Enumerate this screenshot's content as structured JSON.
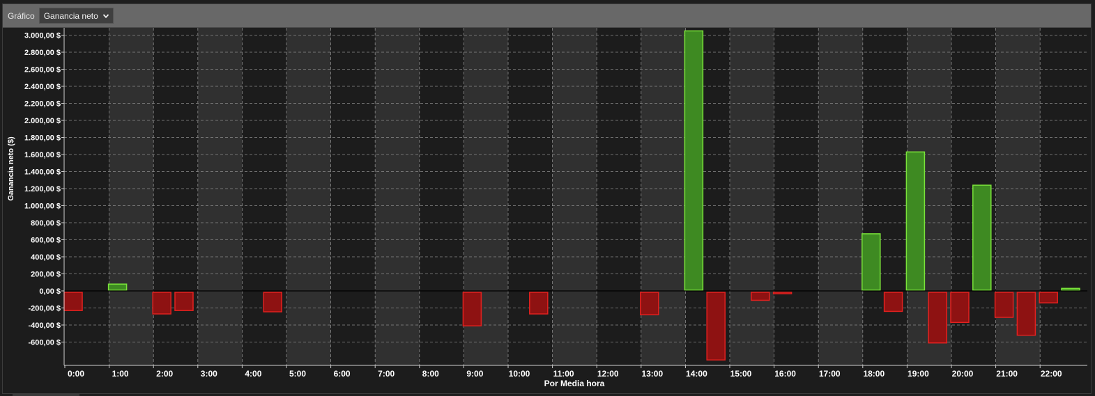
{
  "toolbar": {
    "label": "Gráfico",
    "selected_metric": "Ganancia neto",
    "chevron_icon": "chevron-down-icon"
  },
  "colors": {
    "positive_fill": "#3e8a22",
    "positive_stroke": "#7ae23a",
    "negative_fill": "#8e1212",
    "negative_stroke": "#e3211f",
    "band_light": "#303030",
    "band_dark": "#1c1c1c",
    "grid": "#8a8a8a",
    "text": "#ffffff"
  },
  "chart_data": {
    "type": "bar",
    "title": "",
    "xlabel": "Por Media hora",
    "ylabel": "Ganancia neto ($)",
    "ylim": [
      -850,
      3050
    ],
    "yticks": [
      3000,
      2800,
      2600,
      2400,
      2200,
      2000,
      1800,
      1600,
      1400,
      1200,
      1000,
      800,
      600,
      400,
      200,
      0,
      -200,
      -400,
      -600
    ],
    "ytick_labels": [
      "3.000,00 $",
      "2.800,00 $",
      "2.600,00 $",
      "2.400,00 $",
      "2.200,00 $",
      "2.000,00 $",
      "1.800,00 $",
      "1.600,00 $",
      "1.400,00 $",
      "1.200,00 $",
      "1.000,00 $",
      "800,00 $",
      "600,00 $",
      "400,00 $",
      "200,00 $",
      "0,00 $",
      "-200,00 $",
      "-400,00 $",
      "-600,00 $"
    ],
    "xtick_labels": [
      "0:00",
      "1:00",
      "2:00",
      "3:00",
      "4:00",
      "5:00",
      "6:00",
      "7:00",
      "8:00",
      "9:00",
      "10:00",
      "11:00",
      "12:00",
      "13:00",
      "14:00",
      "15:00",
      "16:00",
      "17:00",
      "18:00",
      "19:00",
      "20:00",
      "21:00",
      "22:00"
    ],
    "grid": true,
    "legend": "none",
    "bars": [
      {
        "x": 0.0,
        "value": -230
      },
      {
        "x": 1.0,
        "value": 80
      },
      {
        "x": 2.0,
        "value": -270
      },
      {
        "x": 2.5,
        "value": -230
      },
      {
        "x": 4.5,
        "value": -245
      },
      {
        "x": 9.0,
        "value": -410
      },
      {
        "x": 10.5,
        "value": -270
      },
      {
        "x": 13.0,
        "value": -280
      },
      {
        "x": 14.0,
        "value": 3050
      },
      {
        "x": 14.5,
        "value": -810
      },
      {
        "x": 15.5,
        "value": -110
      },
      {
        "x": 16.0,
        "value": -20
      },
      {
        "x": 18.0,
        "value": 670
      },
      {
        "x": 18.5,
        "value": -240
      },
      {
        "x": 19.0,
        "value": 1630
      },
      {
        "x": 19.5,
        "value": -610
      },
      {
        "x": 20.0,
        "value": -370
      },
      {
        "x": 20.5,
        "value": 1240
      },
      {
        "x": 21.0,
        "value": -310
      },
      {
        "x": 21.5,
        "value": -520
      },
      {
        "x": 22.0,
        "value": -140
      },
      {
        "x": 22.5,
        "value": 30
      }
    ]
  }
}
